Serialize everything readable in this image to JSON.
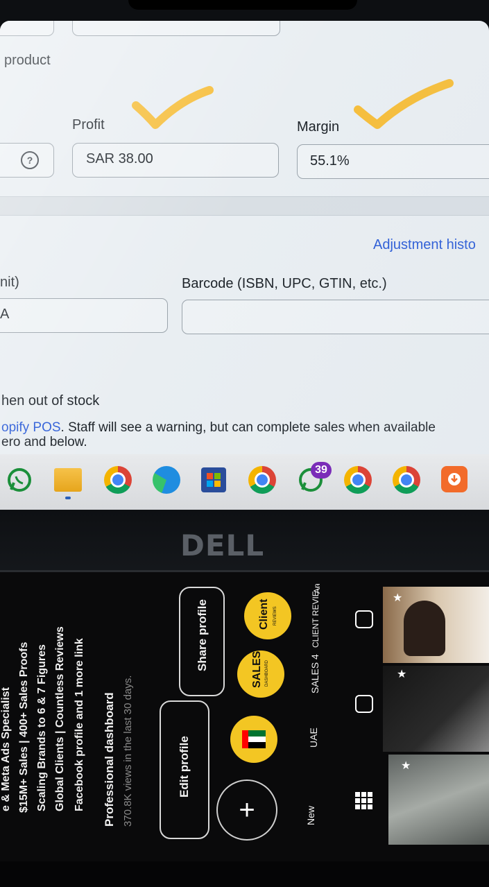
{
  "form": {
    "section_fragment": "product",
    "profit_label": "Profit",
    "profit_value": "SAR 38.00",
    "margin_label": "Margin",
    "margin_value": "55.1%",
    "help_glyph": "?",
    "adjustment_link": "Adjustment histo",
    "unit_label_fragment": "nit)",
    "unit_value_fragment": "A",
    "barcode_label": "Barcode (ISBN, UPC, GTIN, etc.)",
    "stock_heading_fragment": "hen out of stock",
    "pos_link_fragment": "opify POS",
    "pos_text": ". Staff will see a warning, but can complete sales when available",
    "pos_text_2": "ero and below."
  },
  "taskbar": {
    "badge_count": "39",
    "icons": [
      "whatsapp-icon",
      "file-explorer-icon",
      "chrome-icon",
      "edge-icon",
      "store-icon",
      "chrome-profile-icon",
      "whatsapp-badge-icon",
      "chrome-icon",
      "chrome-icon",
      "download-app-icon"
    ]
  },
  "bezel": {
    "brand": "DELL"
  },
  "phone": {
    "bio": [
      "e & Meta Ads Specialist",
      "$15M+ Sales | 400+ Sales Proofs",
      "Scaling Brands to 6 & 7 Figures",
      "Global Clients | Countless Reviews",
      "Facebook profile and 1 more link"
    ],
    "dashboard_title": "Professional dashboard",
    "dashboard_sub": "370.8K views in the last 30 days.",
    "edit_profile": "Edit profile",
    "share_profile": "Share profile",
    "highlights": [
      {
        "label": "New",
        "inner": "+"
      },
      {
        "label": "UAE",
        "inner": ""
      },
      {
        "label": "SALES 4",
        "inner": "SALES"
      },
      {
        "label": "CLIENT REVIE...",
        "inner": "Client"
      },
      {
        "label": "An",
        "inner": ""
      }
    ],
    "highlight_sub_sales": "DASHBOARD",
    "highlight_sub_client": "REVIEWS"
  },
  "colors": {
    "checkmark": "#f6be3b",
    "link": "#2a5bd7",
    "highlight_ring": "#f3c623"
  }
}
